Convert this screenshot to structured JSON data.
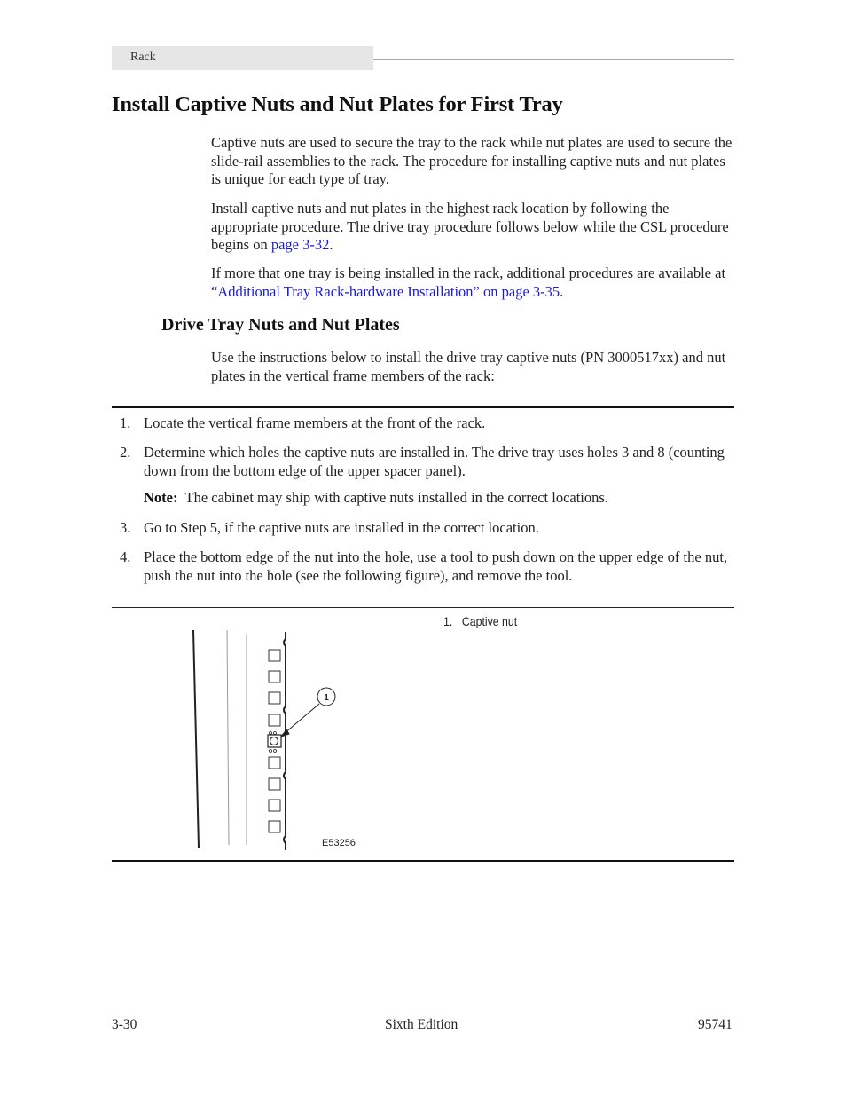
{
  "header": {
    "section_tab": "Rack"
  },
  "title": "Install Captive Nuts and Nut Plates for First Tray",
  "intro": {
    "p1": "Captive nuts are used to secure the tray to the rack while nut plates are used to secure the slide-rail assemblies to the rack. The procedure for installing captive nuts and nut plates is unique for each type of tray.",
    "p2_before": "Install captive nuts and nut plates in the highest rack location by following the appropriate procedure. The drive tray procedure follows below while the CSL procedure begins on ",
    "p2_link": "page 3-32",
    "p2_after": ".",
    "p3_before": "If more that one tray is being installed in the rack, additional procedures are available at ",
    "p3_link": "“Additional Tray Rack-hardware Installation” on page 3-35",
    "p3_after": "."
  },
  "subsection": {
    "title": "Drive Tray Nuts and Nut Plates",
    "intro": "Use the instructions below to install the drive tray captive nuts (PN 3000517xx) and nut plates in the vertical frame members of the rack:"
  },
  "steps": [
    {
      "num": "1.",
      "text": "Locate the vertical frame members at the front of the rack."
    },
    {
      "num": "2.",
      "text": "Determine which holes the captive nuts are installed in. The drive tray uses holes 3 and 8 (counting down from the bottom edge of the upper spacer panel)."
    },
    {
      "num": "3.",
      "text": "Go to Step 5, if the captive nuts are installed in the correct location."
    },
    {
      "num": "4.",
      "text": "Place the bottom edge of the nut into the hole, use a tool to push down on the upper edge of the nut, push the nut into the hole (see the following figure), and remove the tool."
    }
  ],
  "note": {
    "label": "Note:",
    "text": "The cabinet may ship with captive nuts installed in the correct locations."
  },
  "figure": {
    "callout_marker": "1",
    "legend": [
      {
        "num": "1.",
        "label": "Captive nut"
      }
    ],
    "figure_id": "E53256"
  },
  "footer": {
    "page": "3-30",
    "edition": "Sixth Edition",
    "doc_number": "95741"
  },
  "colors": {
    "link": "#1a1adb",
    "header_tab_bg": "#e6e6e6"
  }
}
